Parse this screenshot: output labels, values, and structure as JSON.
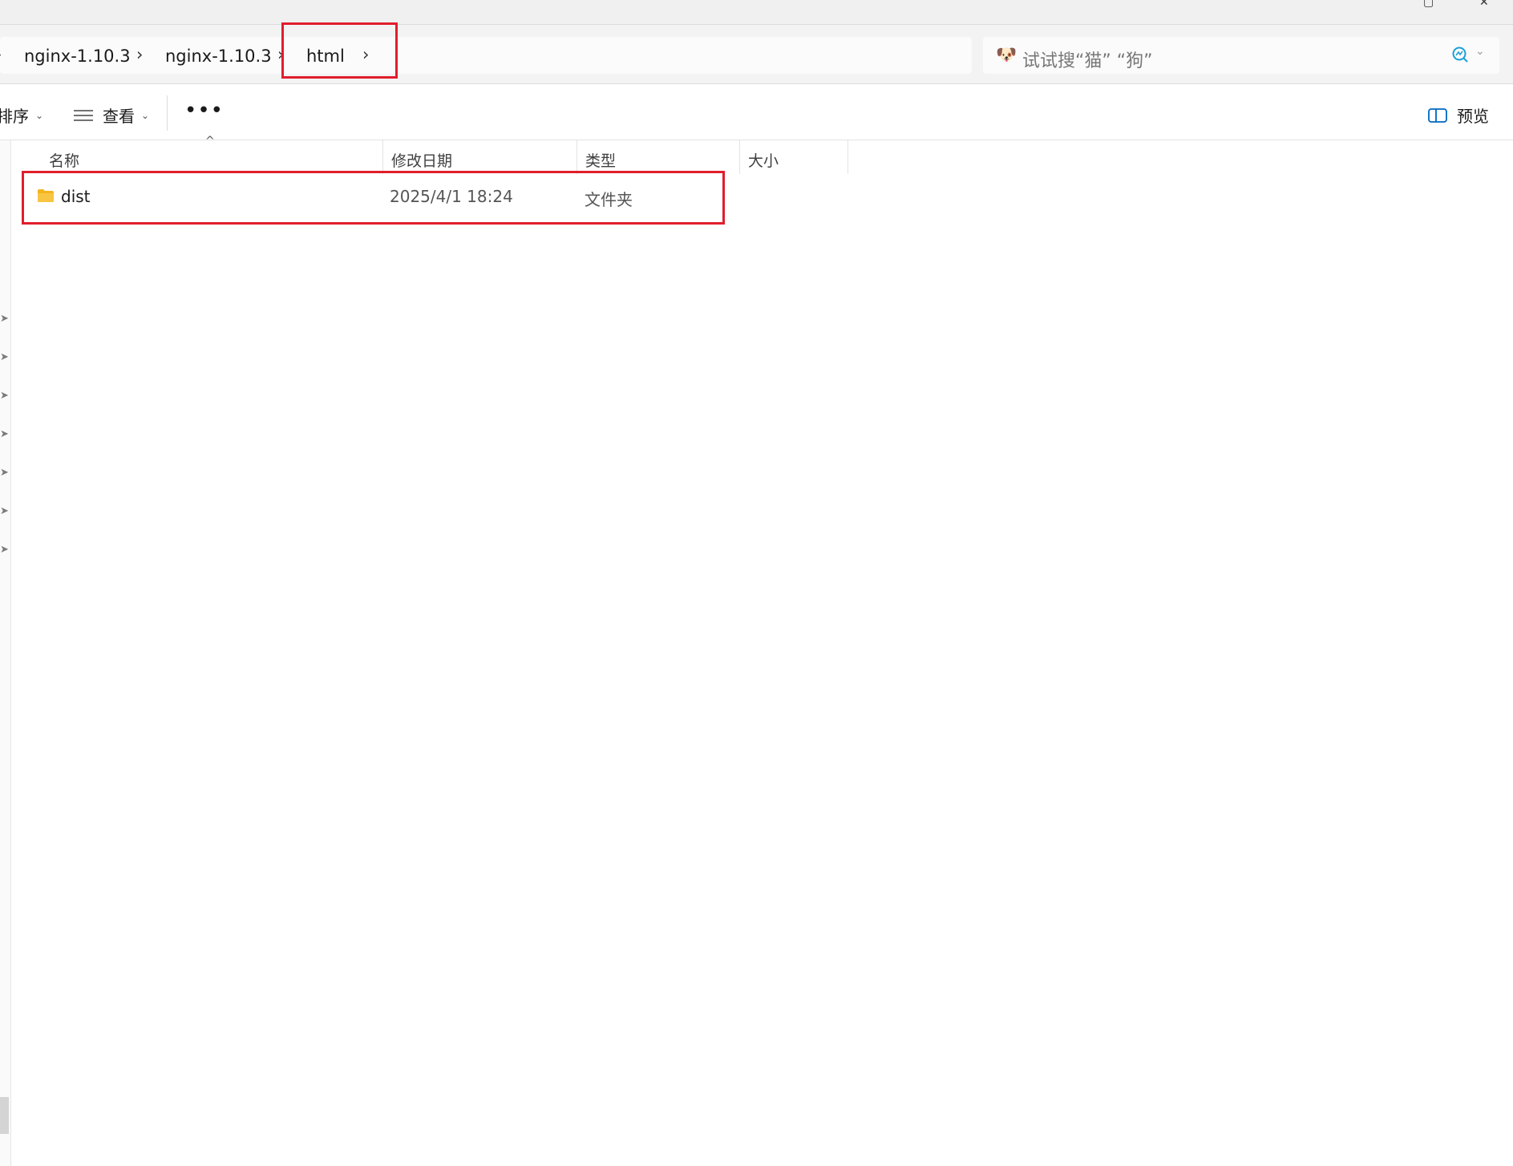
{
  "address_bar": {
    "crumbs": [
      "nginx-1.10.3",
      "nginx-1.10.3",
      "html"
    ]
  },
  "search": {
    "placeholder": "试试搜“猫” “狗”",
    "emoji": "🐶"
  },
  "toolbar": {
    "sort_label": "排序",
    "view_label": "查看",
    "more_label": "•••",
    "preview_label": "预览"
  },
  "columns": {
    "name": "名称",
    "modified": "修改日期",
    "type": "类型",
    "size": "大小"
  },
  "files": [
    {
      "name": "dist",
      "modified": "2025/4/1 18:24",
      "type": "文件夹",
      "size": ""
    }
  ],
  "colors": {
    "annotation": "#e01e2c",
    "folder": "#f8c543",
    "accent": "#0067c0"
  }
}
